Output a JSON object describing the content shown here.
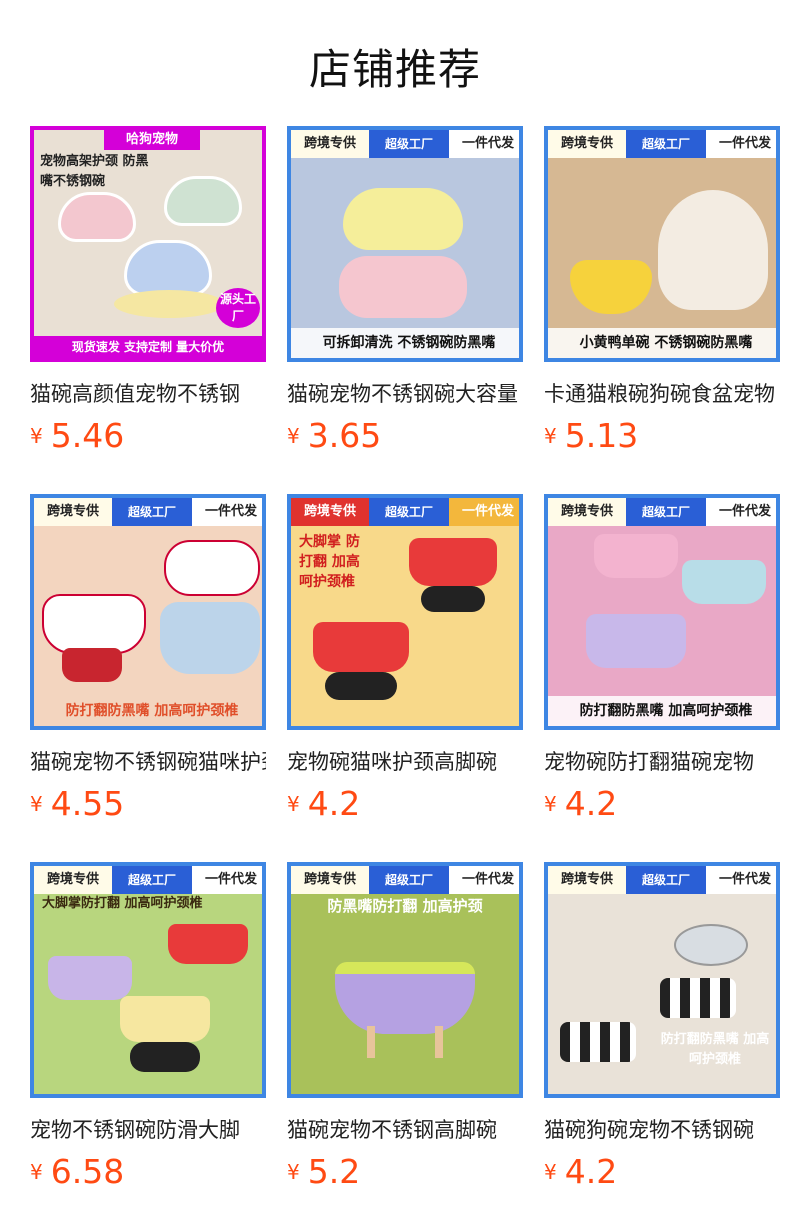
{
  "header": {
    "title": "店铺推荐"
  },
  "products": [
    {
      "title": "猫碗高颜值宠物不锈钢",
      "price_symbol": "¥",
      "price": "5.46",
      "image": {
        "top": "哈狗宠物",
        "overlay": "宠物高架护颈 防黑嘴不锈钢碗",
        "bottom": "现货速发 支持定制 量大价优",
        "corner": "源头工厂",
        "bg": "#e9e0d4",
        "bowl": "#f3c7cf"
      }
    },
    {
      "title": "猫碗宠物不锈钢碗大容量",
      "price_symbol": "¥",
      "price": "3.65",
      "image": {
        "top1": "跨境专供",
        "top2": "超级工厂",
        "top3": "一件代发",
        "bottom": "可拆卸清洗 不锈钢碗防黑嘴",
        "bg": "#b9c7df",
        "bowl": "#f5ee9a",
        "bowl2": "#f5c6cf"
      }
    },
    {
      "title": "卡通猫粮碗狗碗食盆宠物",
      "price_symbol": "¥",
      "price": "5.13",
      "image": {
        "top1": "跨境专供",
        "top2": "超级工厂",
        "top3": "一件代发",
        "bottom": "小黄鸭单碗 不锈钢碗防黑嘴",
        "bg": "#d6b893",
        "bowl": "#f6d23c"
      }
    },
    {
      "title": "猫碗宠物不锈钢碗猫咪护颈",
      "price_symbol": "¥",
      "price": "4.55",
      "image": {
        "top1": "跨境专供",
        "top2": "超级工厂",
        "top3": "一件代发",
        "bottom": "防打翻防黑嘴 加高呵护颈椎",
        "bg": "#f3d5bf",
        "bowl": "#ffffff",
        "bowl2": "#bcd4ea"
      }
    },
    {
      "title": "宠物碗猫咪护颈高脚碗",
      "price_symbol": "¥",
      "price": "4.2",
      "image": {
        "top1": "跨境专供",
        "top2": "超级工厂",
        "top3": "一件代发",
        "overlay": "大脚掌 防打翻 加高呵护颈椎",
        "bg": "#f8d98a",
        "bowl": "#e83a3a"
      }
    },
    {
      "title": "宠物碗防打翻猫碗宠物",
      "price_symbol": "¥",
      "price": "4.2",
      "image": {
        "top1": "跨境专供",
        "top2": "超级工厂",
        "top3": "一件代发",
        "bottom": "防打翻防黑嘴 加高呵护颈椎",
        "bg": "#e9a8c6",
        "bowl": "#f3b3cf",
        "bowl2": "#b8dde8"
      }
    },
    {
      "title": "宠物不锈钢碗防滑大脚",
      "price_symbol": "¥",
      "price": "6.58",
      "image": {
        "top1": "跨境专供",
        "top2": "超级工厂",
        "top3": "一件代发",
        "overlay": "大脚掌防打翻 加高呵护颈椎",
        "bg": "#b8d67e",
        "bowl": "#c8b5e8",
        "bowl2": "#e83a3a"
      }
    },
    {
      "title": "猫碗宠物不锈钢高脚碗",
      "price_symbol": "¥",
      "price": "5.2",
      "image": {
        "top1": "跨境专供",
        "top2": "超级工厂",
        "top3": "一件代发",
        "overlay": "防黑嘴防打翻 加高护颈",
        "bg": "#a9c15a",
        "bowl": "#b5a1e2"
      }
    },
    {
      "title": "猫碗狗碗宠物不锈钢碗",
      "price_symbol": "¥",
      "price": "4.2",
      "image": {
        "top1": "跨境专供",
        "top2": "超级工厂",
        "top3": "一件代发",
        "overlay": "防打翻防黑嘴 加高呵护颈椎",
        "bg": "#e9e2d8",
        "bowl": "#222222"
      }
    }
  ]
}
